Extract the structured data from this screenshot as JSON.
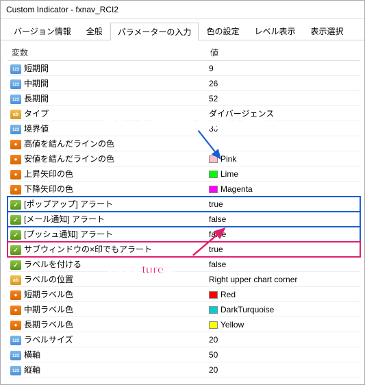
{
  "window": {
    "title": "Custom Indicator - fxnav_RCI2"
  },
  "tabs": {
    "items": [
      {
        "label": "バージョン情報"
      },
      {
        "label": "全般"
      },
      {
        "label": "パラメーターの入力",
        "active": true
      },
      {
        "label": "色の設定"
      },
      {
        "label": "レベル表示"
      },
      {
        "label": "表示選択"
      }
    ]
  },
  "headers": {
    "variable": "変数",
    "value": "値"
  },
  "rows": [
    {
      "icon": "num",
      "name": "短期間",
      "value": "9"
    },
    {
      "icon": "num",
      "name": "中期間",
      "value": "26"
    },
    {
      "icon": "num",
      "name": "長期間",
      "value": "52"
    },
    {
      "icon": "str",
      "name": "タイプ",
      "value": "ダイバージェンス"
    },
    {
      "icon": "num",
      "name": "境界値",
      "value": "80"
    },
    {
      "icon": "color",
      "name": "高値を結んだラインの色",
      "value": ""
    },
    {
      "icon": "color",
      "name": "安値を結んだラインの色",
      "value": "Pink",
      "swatch": "#ffc0cb"
    },
    {
      "icon": "color",
      "name": "上昇矢印の色",
      "value": "Lime",
      "swatch": "#00ff00"
    },
    {
      "icon": "color",
      "name": "下降矢印の色",
      "value": "Magenta",
      "swatch": "#ff00ff"
    },
    {
      "icon": "bool",
      "name": "[ポップアップ] アラート",
      "value": "true",
      "group": "blue"
    },
    {
      "icon": "bool",
      "name": "[メール通知] アラート",
      "value": "false",
      "group": "blue"
    },
    {
      "icon": "bool",
      "name": "[プッシュ通知] アラート",
      "value": "false",
      "group": "blue"
    },
    {
      "icon": "bool",
      "name": "サブウィンドウの×印でもアラート",
      "value": "true",
      "group": "red"
    },
    {
      "icon": "bool",
      "name": "ラベルを付ける",
      "value": "false"
    },
    {
      "icon": "str",
      "name": "ラベルの位置",
      "value": "Right upper chart corner"
    },
    {
      "icon": "color",
      "name": "短期ラベル色",
      "value": "Red",
      "swatch": "#ff0000"
    },
    {
      "icon": "color",
      "name": "中期ラベル色",
      "value": "DarkTurquoise",
      "swatch": "#00ced1"
    },
    {
      "icon": "color",
      "name": "長期ラベル色",
      "value": "Yellow",
      "swatch": "#ffff00"
    },
    {
      "icon": "num",
      "name": "ラベルサイズ",
      "value": "20"
    },
    {
      "icon": "num",
      "name": "横軸",
      "value": "50"
    },
    {
      "icon": "num",
      "name": "縦軸",
      "value": "20"
    }
  ],
  "annotations": {
    "top": "アラートの種類も選んでください",
    "bottom": "これをtureに"
  }
}
